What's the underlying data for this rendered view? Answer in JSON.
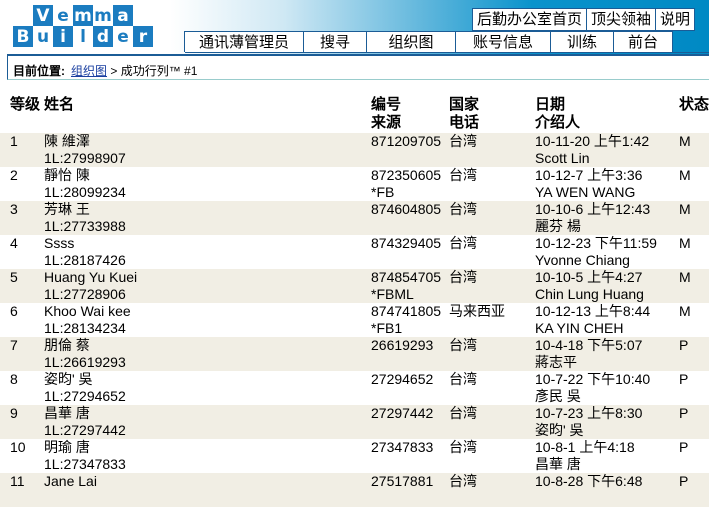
{
  "logo": {
    "line1": [
      "V",
      "e",
      "m",
      "m",
      "a"
    ],
    "line2": [
      "B",
      "u",
      "i",
      "l",
      "d",
      "e",
      "r"
    ]
  },
  "top_links": [
    "后勤办公室首页",
    "顶尖领袖",
    "说明"
  ],
  "nav": [
    "通讯薄管理员",
    "搜寻",
    "组织图",
    "账号信息",
    "训练",
    "前台"
  ],
  "breadcrumb": {
    "label": "目前位置:",
    "link": "组织图",
    "rest": " > 成功行列™ #1"
  },
  "columns": {
    "rank": "等级",
    "name": "姓名",
    "id": "编号",
    "source": "来源",
    "country": "国家",
    "phone": "电话",
    "date": "日期",
    "referrer": "介绍人",
    "status": "状态"
  },
  "rows": [
    {
      "rank": "1",
      "name": "陳 維澤",
      "sub": "1L:27998907",
      "id": "871209705",
      "source": "",
      "country": "台湾",
      "date": "10-11-20 上午1:42",
      "referrer": "Scott Lin",
      "status": "M"
    },
    {
      "rank": "2",
      "name": "靜怡 陳",
      "sub": "1L:28099234",
      "id": "872350605",
      "source": "*FB",
      "country": "台湾",
      "date": "10-12-7 上午3:36",
      "referrer": "YA WEN WANG",
      "status": "M"
    },
    {
      "rank": "3",
      "name": "芳琳 王",
      "sub": "1L:27733988",
      "id": "874604805",
      "source": "",
      "country": "台湾",
      "date": "10-10-6 上午12:43",
      "referrer": "麗芬 楊",
      "status": "M"
    },
    {
      "rank": "4",
      "name": "Ssss",
      "sub": "1L:28187426",
      "id": "874329405",
      "source": "",
      "country": "台湾",
      "date": "10-12-23 下午11:59",
      "referrer": "Yvonne Chiang",
      "status": "M"
    },
    {
      "rank": "5",
      "name": "Huang Yu Kuei",
      "sub": "1L:27728906",
      "id": "874854705",
      "source": "*FBML",
      "country": "台湾",
      "date": "10-10-5 上午4:27",
      "referrer": "Chin Lung Huang",
      "status": "M"
    },
    {
      "rank": "6",
      "name": "Khoo Wai kee",
      "sub": "1L:28134234",
      "id": "874741805",
      "source": "*FB1",
      "country": "马来西亚",
      "date": "10-12-13 上午8:44",
      "referrer": "KA YIN CHEH",
      "status": "M"
    },
    {
      "rank": "7",
      "name": "朋倫 蔡",
      "sub": "1L:26619293",
      "id": "26619293",
      "source": "",
      "country": "台湾",
      "date": "10-4-18 下午5:07",
      "referrer": "蔣志平",
      "status": "P"
    },
    {
      "rank": "8",
      "name": "姿昀' 吳",
      "sub": "1L:27294652",
      "id": "27294652",
      "source": "",
      "country": "台湾",
      "date": "10-7-22 下午10:40",
      "referrer": "彥民 吳",
      "status": "P"
    },
    {
      "rank": "9",
      "name": "昌華 唐",
      "sub": "1L:27297442",
      "id": "27297442",
      "source": "",
      "country": "台湾",
      "date": "10-7-23 上午8:30",
      "referrer": "姿昀' 吳",
      "status": "P"
    },
    {
      "rank": "10",
      "name": "明瑜 唐",
      "sub": "1L:27347833",
      "id": "27347833",
      "source": "",
      "country": "台湾",
      "date": "10-8-1 上午4:18",
      "referrer": "昌華 唐",
      "status": "P"
    },
    {
      "rank": "11",
      "name": "Jane Lai",
      "sub": "",
      "id": "27517881",
      "source": "",
      "country": "台湾",
      "date": "10-8-28 下午6:48",
      "referrer": "",
      "status": "P"
    }
  ]
}
